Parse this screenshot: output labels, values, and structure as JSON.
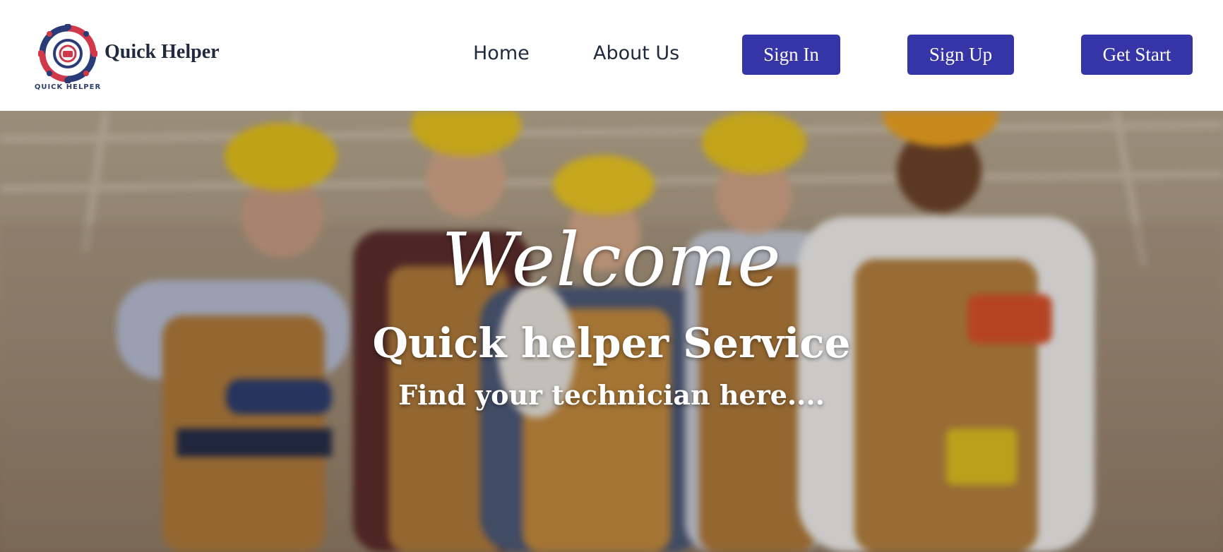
{
  "header": {
    "brand": "Quick Helper",
    "logo_caption": "QUICK HELPER",
    "nav": {
      "home": "Home",
      "about": "About Us"
    },
    "buttons": {
      "sign_in": "Sign In",
      "sign_up": "Sign Up",
      "get_start": "Get Start"
    }
  },
  "hero": {
    "welcome": "Welcome",
    "title": "Quick helper Service",
    "tagline": "Find your technician here...."
  },
  "colors": {
    "button": "#3535a8",
    "text_dark": "#1f2a3d",
    "logo_red": "#d0394a",
    "logo_navy": "#2a3c78"
  },
  "icons": [
    "quick-helper-logo-icon"
  ]
}
